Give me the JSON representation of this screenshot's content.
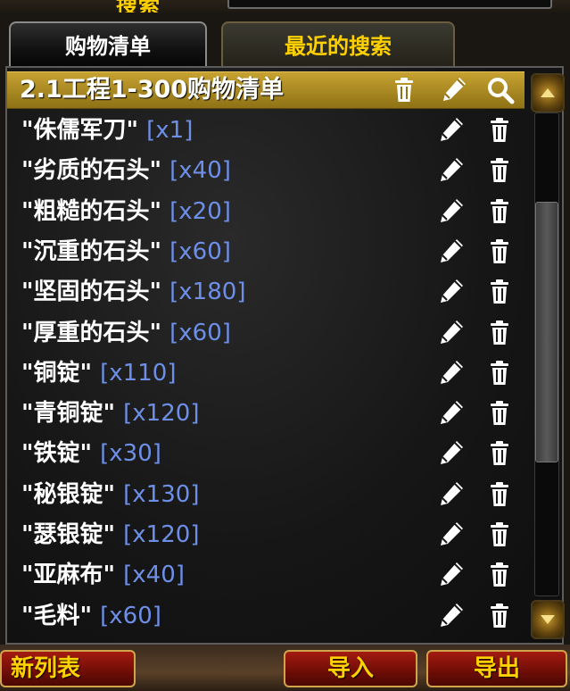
{
  "window": {
    "title_fragment": "搜索"
  },
  "tabs": [
    {
      "label": "购物清单",
      "active": true
    },
    {
      "label": "最近的搜索",
      "active": false
    }
  ],
  "list_header": {
    "name": "2.1工程1-300购物清单"
  },
  "items": [
    {
      "name": "\"侏儒军刀\" ",
      "qty": "[x1]"
    },
    {
      "name": "\"劣质的石头\" ",
      "qty": "[x40]"
    },
    {
      "name": "\"粗糙的石头\" ",
      "qty": "[x20]"
    },
    {
      "name": "\"沉重的石头\" ",
      "qty": "[x60]"
    },
    {
      "name": "\"坚固的石头\" ",
      "qty": "[x180]"
    },
    {
      "name": "\"厚重的石头\" ",
      "qty": "[x60]"
    },
    {
      "name": "\"铜锭\" ",
      "qty": "[x110]"
    },
    {
      "name": "\"青铜锭\" ",
      "qty": "[x120]"
    },
    {
      "name": "\"铁锭\" ",
      "qty": "[x30]"
    },
    {
      "name": "\"秘银锭\" ",
      "qty": "[x130]"
    },
    {
      "name": "\"瑟银锭\" ",
      "qty": "[x120]"
    },
    {
      "name": "\"亚麻布\" ",
      "qty": "[x40]"
    },
    {
      "name": "\"毛料\" ",
      "qty": "[x60]"
    }
  ],
  "buttons": {
    "new_list": "新列表",
    "import": "导入",
    "export": "导出"
  },
  "colors": {
    "gold": "#ffd100",
    "quantity": "#6e8fe8",
    "header_bar": "#c7a232",
    "button_red": "#a31b10"
  },
  "icons": {
    "delete": "trash-icon",
    "edit": "pencil-icon",
    "search": "magnifier-icon"
  }
}
